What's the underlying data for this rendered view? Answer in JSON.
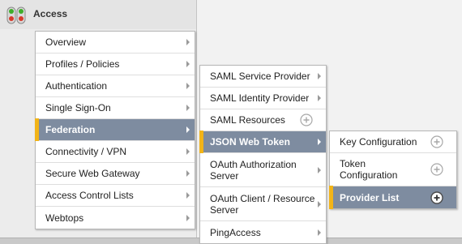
{
  "app": {
    "title": "Access",
    "icon": "traffic-light-icon"
  },
  "menu_level1": {
    "items": [
      {
        "label": "Overview",
        "has_submenu": true
      },
      {
        "label": "Profiles / Policies",
        "has_submenu": true
      },
      {
        "label": "Authentication",
        "has_submenu": true
      },
      {
        "label": "Single Sign-On",
        "has_submenu": true
      },
      {
        "label": "Federation",
        "has_submenu": true,
        "active": true
      },
      {
        "label": "Connectivity / VPN",
        "has_submenu": true
      },
      {
        "label": "Secure Web Gateway",
        "has_submenu": true
      },
      {
        "label": "Access Control Lists",
        "has_submenu": true
      },
      {
        "label": "Webtops",
        "has_submenu": true
      }
    ]
  },
  "menu_level2": {
    "items": [
      {
        "label": "SAML Service Provider",
        "has_submenu": true
      },
      {
        "label": "SAML Identity Provider",
        "has_submenu": true
      },
      {
        "label": "SAML Resources",
        "action": "plus-circle-icon"
      },
      {
        "label": "JSON Web Token",
        "has_submenu": true,
        "active": true
      },
      {
        "label": "OAuth Authorization Server",
        "has_submenu": true
      },
      {
        "label": "OAuth Client / Resource Server",
        "has_submenu": true
      },
      {
        "label": "PingAccess",
        "has_submenu": true
      }
    ]
  },
  "menu_level3": {
    "items": [
      {
        "label": "Key Configuration",
        "action": "plus-circle-icon"
      },
      {
        "label": "Token Configuration",
        "action": "plus-circle-icon"
      },
      {
        "label": "Provider List",
        "action": "plus-circle-icon",
        "selected": true
      }
    ]
  },
  "colors": {
    "active_bg": "#7e8ca0",
    "active_marker": "#f2b418",
    "menu_bg": "#ffffff"
  }
}
